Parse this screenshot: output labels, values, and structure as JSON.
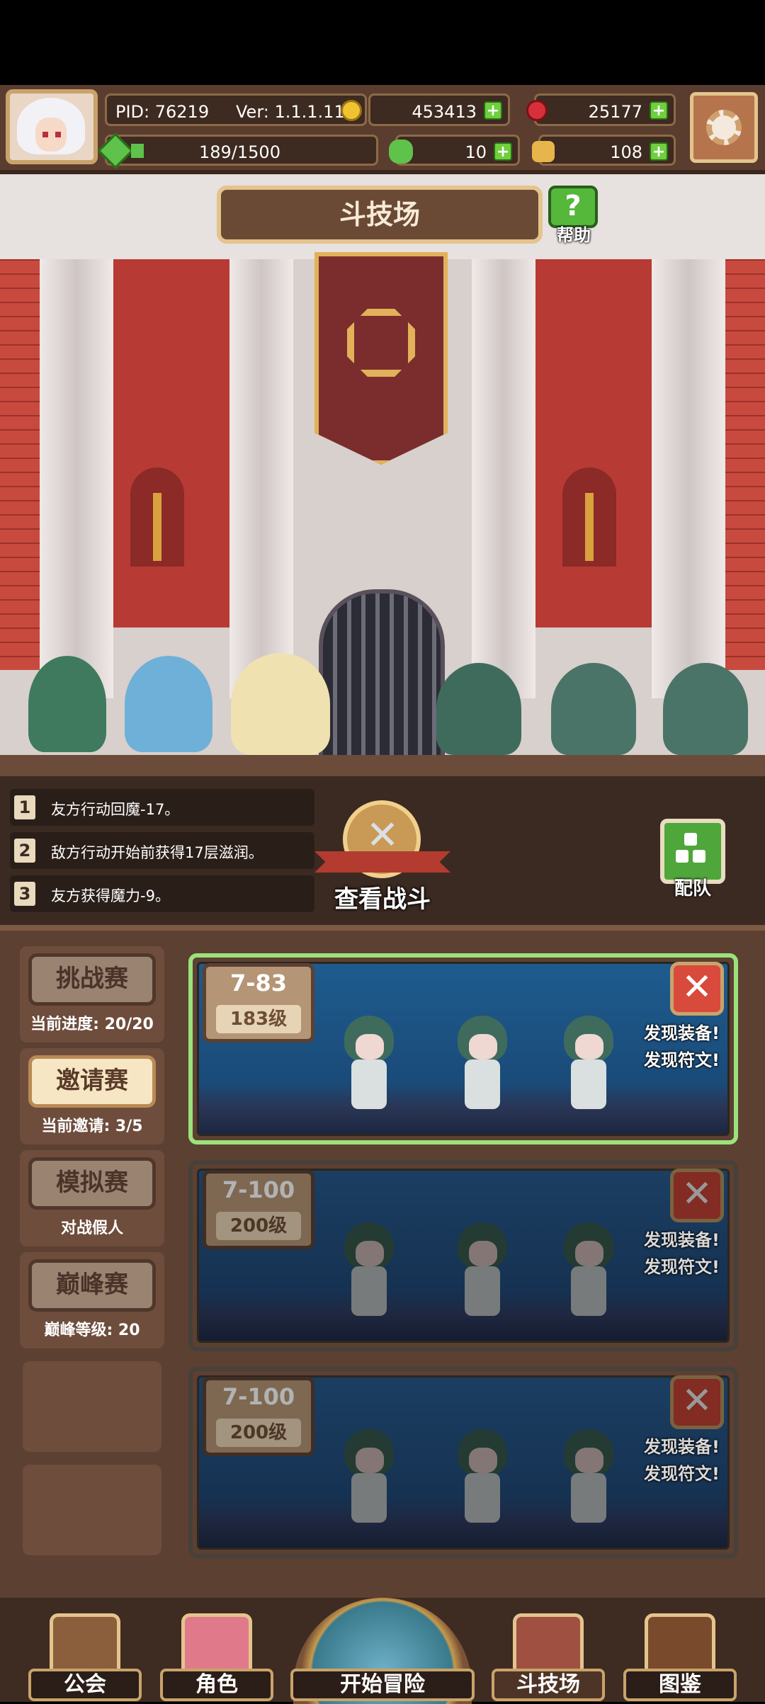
{
  "header": {
    "pid": "PID: 76219",
    "version": "Ver: 1.1.1.11",
    "gold": "453413",
    "gems": "25177",
    "stamina": "189/1500",
    "clover": "10",
    "bread": "108"
  },
  "arena": {
    "title": "斗技场",
    "help_label": "帮助"
  },
  "battle_log": [
    {
      "num": "1",
      "text": "友方行动回魔-17。"
    },
    {
      "num": "2",
      "text": "敌方行动开始前获得17层滋润。"
    },
    {
      "num": "3",
      "text": "友方获得魔力-9。"
    }
  ],
  "view_battle_label": "查看战斗",
  "team_label": "配队",
  "modes": [
    {
      "label": "挑战赛",
      "sub": "当前进度: 20/20"
    },
    {
      "label": "邀请赛",
      "sub": "当前邀请: 3/5"
    },
    {
      "label": "模拟赛",
      "sub": "对战假人"
    },
    {
      "label": "巅峰赛",
      "sub": "巅峰等级: 20"
    }
  ],
  "opponents": [
    {
      "stage": "7-83",
      "level": "183级",
      "loot1": "发现装备!",
      "loot2": "发现符文!"
    },
    {
      "stage": "7-100",
      "level": "200级",
      "loot1": "发现装备!",
      "loot2": "发现符文!"
    },
    {
      "stage": "7-100",
      "level": "200级",
      "loot1": "发现装备!",
      "loot2": "发现符文!"
    }
  ],
  "nav": {
    "guild": "公会",
    "character": "角色",
    "adventure": "开始冒险",
    "arena": "斗技场",
    "codex": "图鉴"
  },
  "icons": {
    "settings": "gear-icon",
    "gold": "coin-icon",
    "gem": "red-gem-icon",
    "stamina": "green-gem-icon",
    "clover": "clover-icon",
    "bread": "bread-icon",
    "close": "close-icon",
    "help": "question-icon",
    "battle": "crossed-swords-icon"
  },
  "colors": {
    "panel": "#5c4032",
    "card_selected_border": "#9be27a",
    "close_button": "#d84a3b",
    "plus_button": "#6fcf3c"
  }
}
